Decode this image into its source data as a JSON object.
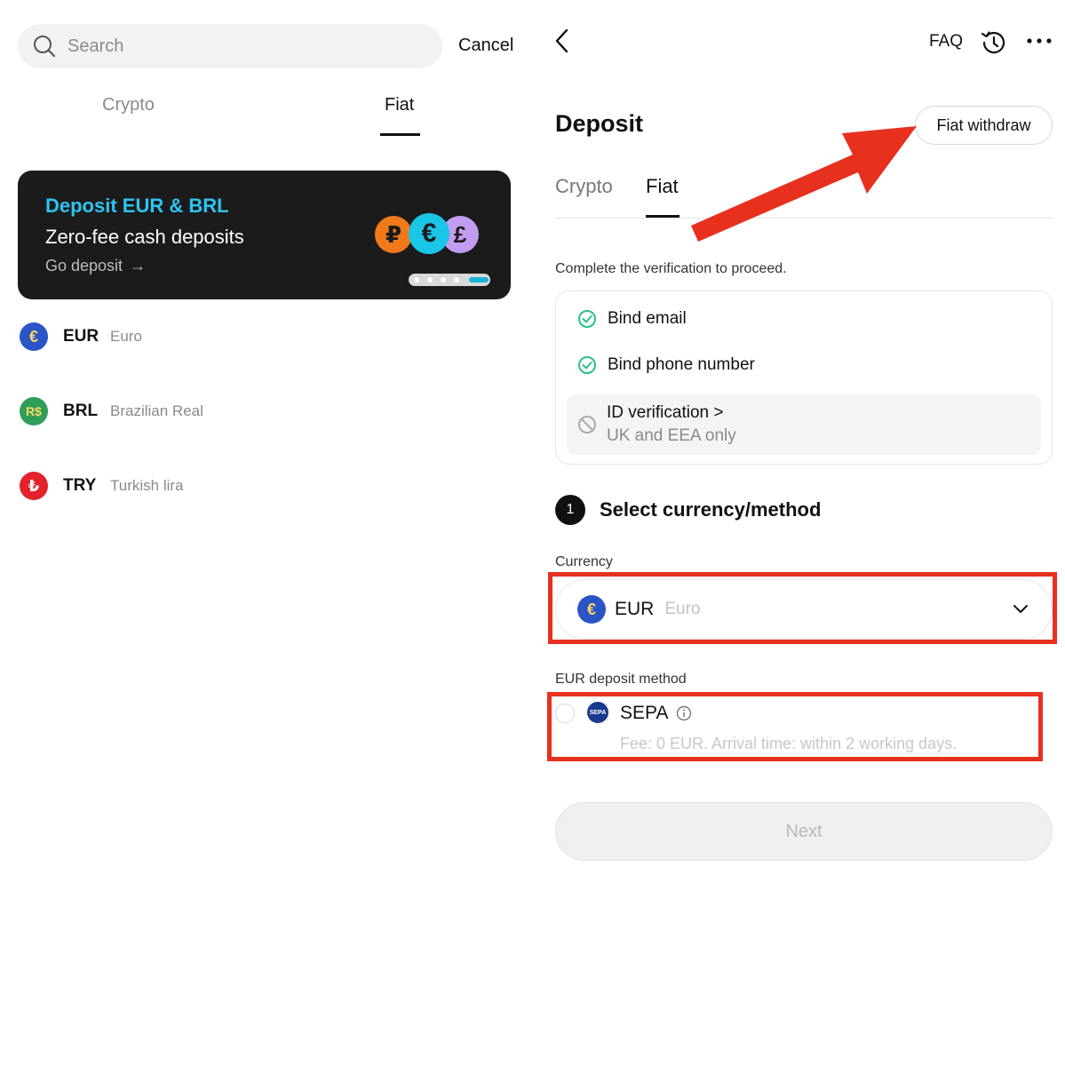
{
  "left": {
    "search": {
      "placeholder": "Search",
      "cancel_label": "Cancel"
    },
    "tabs": [
      {
        "label": "Crypto",
        "active": false
      },
      {
        "label": "Fiat",
        "active": true
      }
    ],
    "banner": {
      "title": "Deposit EUR & BRL",
      "subtitle": "Zero-fee cash deposits",
      "link": "Go deposit",
      "link_arrow": "→",
      "coins": [
        "₽",
        "€",
        "£"
      ]
    },
    "currencies": [
      {
        "symbol": "€",
        "code": "EUR",
        "name": "Euro",
        "color": "#2a55c7"
      },
      {
        "symbol": "R$",
        "code": "BRL",
        "name": "Brazilian Real",
        "color": "#2f9e5a"
      },
      {
        "symbol": "₺",
        "code": "TRY",
        "name": "Turkish lira",
        "color": "#e2242a"
      }
    ]
  },
  "right": {
    "header": {
      "faq_label": "FAQ",
      "more_icon": "more-icon",
      "history_icon": "history-icon",
      "back_icon": "back-icon"
    },
    "title": "Deposit",
    "fiat_withdraw_label": "Fiat withdraw",
    "tabs": [
      {
        "label": "Crypto",
        "active": false
      },
      {
        "label": "Fiat",
        "active": true
      }
    ],
    "verification": {
      "note": "Complete the verification to proceed.",
      "items": [
        {
          "label": "Bind email",
          "status": "done"
        },
        {
          "label": "Bind phone number",
          "status": "done"
        }
      ],
      "id_item": {
        "label": "ID verification >",
        "sub": "UK and EEA only",
        "status": "unavailable"
      }
    },
    "step": {
      "number": "1",
      "title": "Select currency/method"
    },
    "currency_field": {
      "label": "Currency",
      "symbol": "€",
      "code": "EUR",
      "name": "Euro"
    },
    "method_field": {
      "label": "EUR deposit method",
      "method_name": "SEPA",
      "logo_text": "SEPA",
      "fee": "Fee: 0 EUR. Arrival time: within 2 working days."
    },
    "next_label": "Next"
  },
  "colors": {
    "accent_cyan": "#2ec4f0",
    "annotation_red": "#e8301f",
    "check_green": "#2bbf8a"
  }
}
